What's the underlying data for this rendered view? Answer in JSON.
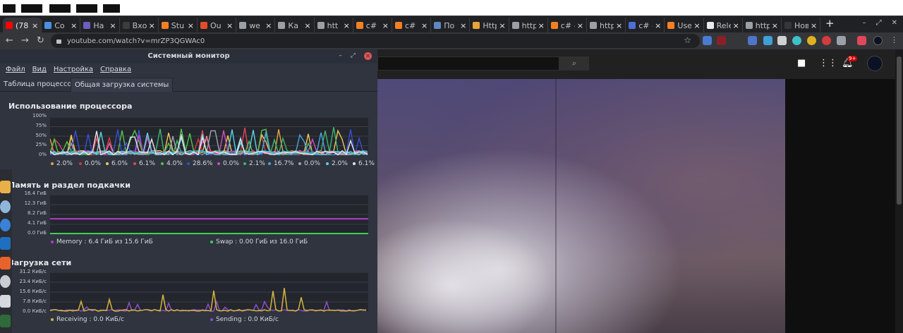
{
  "browser": {
    "tabs": [
      {
        "title": "(78",
        "color": "#ff0000",
        "active": true
      },
      {
        "title": "Co",
        "color": "#4a90e2"
      },
      {
        "title": "На",
        "color": "#6b5fbd"
      },
      {
        "title": "Вхо",
        "color": "#3c3c3c"
      },
      {
        "title": "Stu",
        "color": "#f48024"
      },
      {
        "title": "Ou",
        "color": "#e14d2a"
      },
      {
        "title": "we",
        "color": "#9aa0a6"
      },
      {
        "title": "Ка",
        "color": "#9aa0a6"
      },
      {
        "title": "htt",
        "color": "#9aa0a6"
      },
      {
        "title": "c#",
        "color": "#f48024"
      },
      {
        "title": "c#",
        "color": "#f48024"
      },
      {
        "title": "По",
        "color": "#5f88c2"
      },
      {
        "title": "HttpC",
        "color": "#e8a33d"
      },
      {
        "title": "httpcli",
        "color": "#9aa0a6"
      },
      {
        "title": "c# - H",
        "color": "#f48024"
      },
      {
        "title": "httpcli",
        "color": "#9aa0a6"
      },
      {
        "title": "c# - H",
        "color": "#4c6fd6"
      },
      {
        "title": "User S",
        "color": "#f48024"
      },
      {
        "title": "Relea",
        "color": "#e8eaed"
      },
      {
        "title": "https:",
        "color": "#9aa0a6"
      },
      {
        "title": "Новая вк",
        "color": "#35363a"
      }
    ],
    "new_tab_glyph": "+",
    "close_glyph": "×",
    "url": "youtube.com/watch?v=mrZP3QGWAc0",
    "window_controls": [
      "–",
      "⤢",
      "✕"
    ]
  },
  "youtube": {
    "search_icon": "⌕",
    "notification_badge": "9+",
    "icons": [
      "video-camera-icon",
      "apps-grid-icon",
      "bell-icon"
    ]
  },
  "sysmon": {
    "title": "Системный монитор",
    "menu": [
      "Файл",
      "Вид",
      "Настройка",
      "Справка"
    ],
    "tabs": [
      "Таблица процессов",
      "Общая загрузка системы"
    ],
    "active_tab": 1,
    "cpu": {
      "heading": "Использование процессора",
      "yticks": [
        "100%",
        "75%",
        "50%",
        "25%",
        "0%"
      ],
      "legend": [
        {
          "label": "2.0%",
          "color": "#e8a33d"
        },
        {
          "label": "0.0%",
          "color": "#cc3b3b"
        },
        {
          "label": "6.0%",
          "color": "#f1c75a"
        },
        {
          "label": "6.1%",
          "color": "#e0475a"
        },
        {
          "label": "4.0%",
          "color": "#57c24a"
        },
        {
          "label": "28.6%",
          "color": "#3a4fd6"
        },
        {
          "label": "0.0%",
          "color": "#d34ac2"
        },
        {
          "label": "2.1%",
          "color": "#3fb66b"
        },
        {
          "label": "16.7%",
          "color": "#4aa3e0"
        },
        {
          "label": "0.0%",
          "color": "#9fa5b0"
        },
        {
          "label": "2.0%",
          "color": "#5ad0e6"
        },
        {
          "label": "6.1%",
          "color": "#e6e6e6"
        }
      ]
    },
    "memory": {
      "heading": "Память и раздел подкачки",
      "yticks": [
        "16.4 ГиБ",
        "12.3 ГиБ",
        "8.2 ГиБ",
        "4.1 ГиБ",
        "0.0 ГиБ"
      ],
      "ymax": 16.4,
      "memory_label": "Memory : 6.4 ГиБ из 15.6 ГиБ",
      "memory_value": 6.4,
      "memory_color": "#b03fc9",
      "swap_label": "Swap : 0.00 ГиБ из 16.0 ГиБ",
      "swap_value": 0.0,
      "swap_color": "#3fcf5a"
    },
    "network": {
      "heading": "Загрузка сети",
      "yticks": [
        "31.2 КиБ/с",
        "23.4 КиБ/с",
        "15.6 КиБ/с",
        "7.8 КиБ/с",
        "0.0 КиБ/с"
      ],
      "receiving_label": "Receiving : 0.0 КиБ/с",
      "receiving_color": "#d4b43d",
      "sending_label": "Sending : 0.0 КиБ/с",
      "sending_color": "#8a4fc9"
    }
  }
}
